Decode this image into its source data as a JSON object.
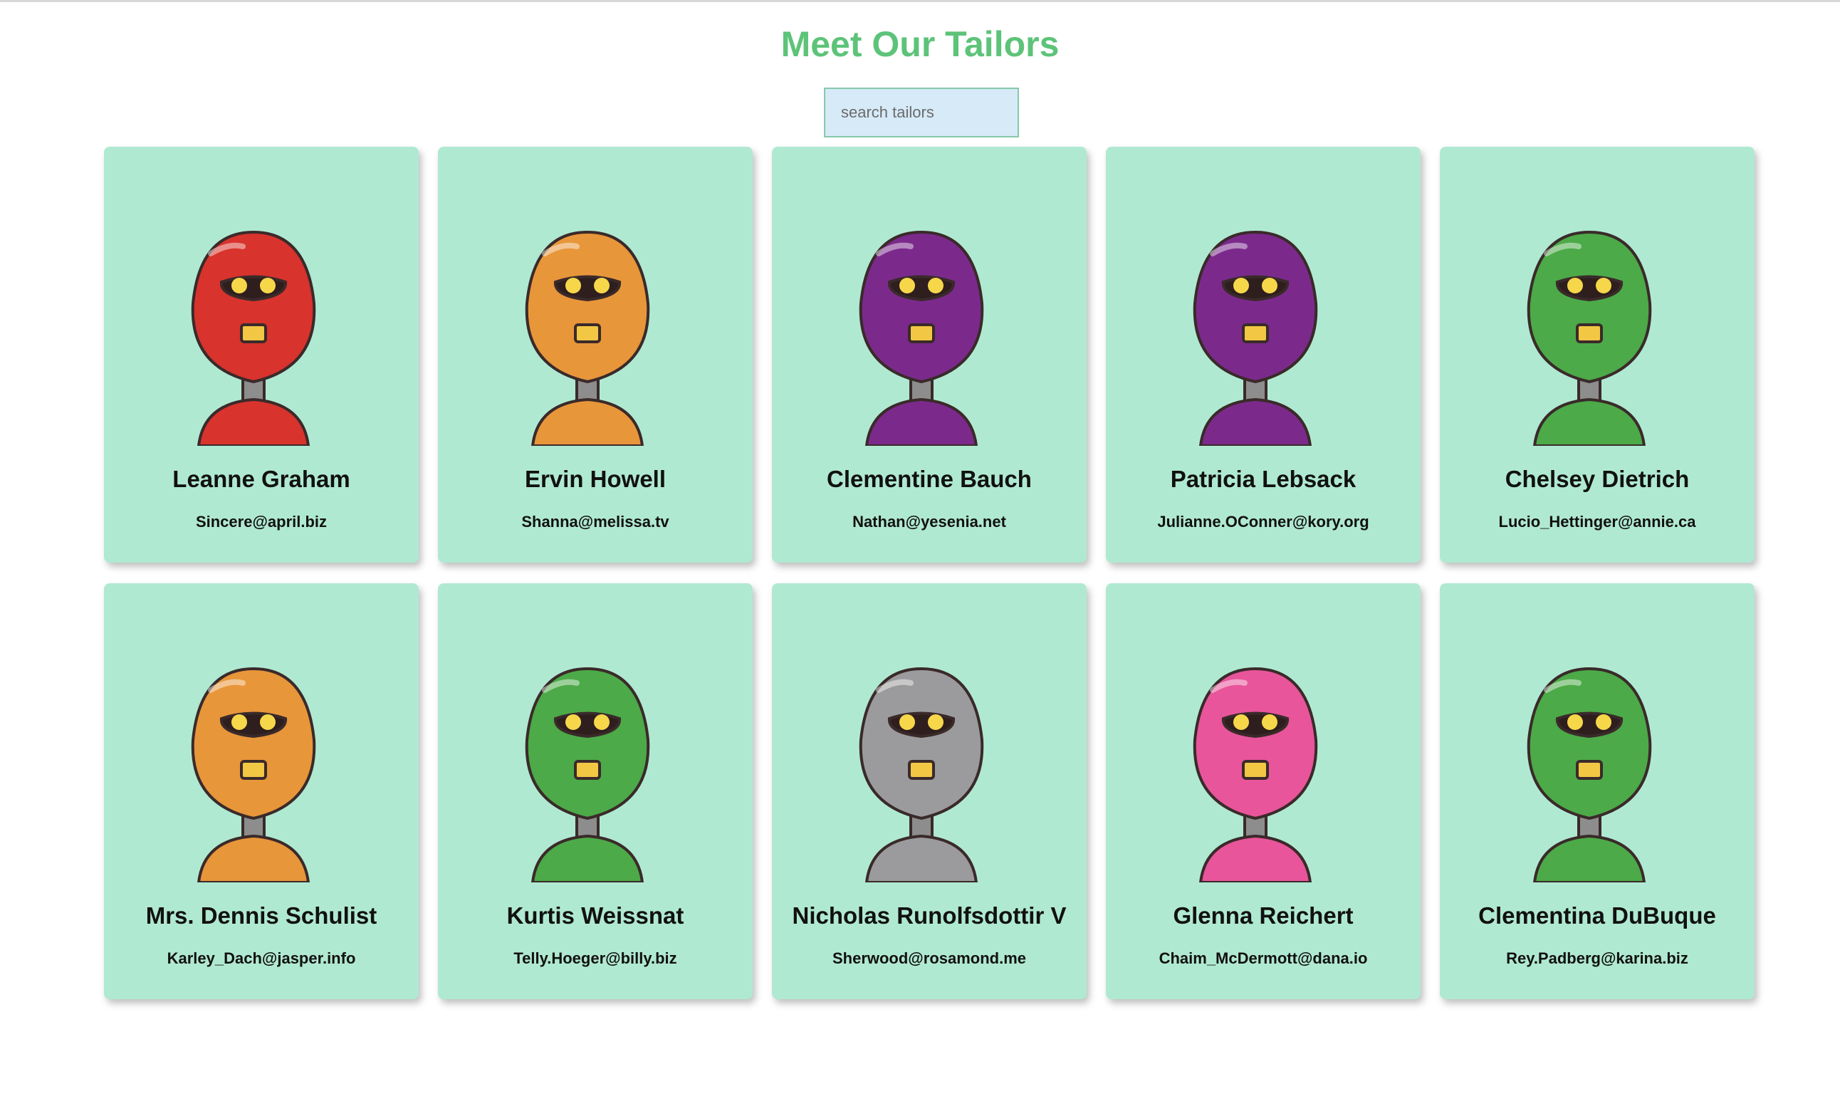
{
  "page": {
    "title": "Meet Our Tailors"
  },
  "search": {
    "placeholder": "search tailors",
    "value": ""
  },
  "tailors": [
    {
      "name": "Leanne Graham",
      "email": "Sincere@april.biz",
      "robot_color": "#d8332d",
      "avatar_icon": "red-robot-avatar"
    },
    {
      "name": "Ervin Howell",
      "email": "Shanna@melissa.tv",
      "robot_color": "#e8963a",
      "avatar_icon": "orange-robot-avatar"
    },
    {
      "name": "Clementine Bauch",
      "email": "Nathan@yesenia.net",
      "robot_color": "#7b2a8c",
      "avatar_icon": "purple-robot-avatar"
    },
    {
      "name": "Patricia Lebsack",
      "email": "Julianne.OConner@kory.org",
      "robot_color": "#7b2a8c",
      "avatar_icon": "purple-robot-avatar"
    },
    {
      "name": "Chelsey Dietrich",
      "email": "Lucio_Hettinger@annie.ca",
      "robot_color": "#4caa48",
      "avatar_icon": "green-robot-avatar"
    },
    {
      "name": "Mrs. Dennis Schulist",
      "email": "Karley_Dach@jasper.info",
      "robot_color": "#e8963a",
      "avatar_icon": "orange-robot-avatar"
    },
    {
      "name": "Kurtis Weissnat",
      "email": "Telly.Hoeger@billy.biz",
      "robot_color": "#4caa48",
      "avatar_icon": "green-robot-avatar"
    },
    {
      "name": "Nicholas Runolfsdottir V",
      "email": "Sherwood@rosamond.me",
      "robot_color": "#9b9b9d",
      "avatar_icon": "gray-robot-avatar"
    },
    {
      "name": "Glenna Reichert",
      "email": "Chaim_McDermott@dana.io",
      "robot_color": "#e8559a",
      "avatar_icon": "pink-robot-avatar"
    },
    {
      "name": "Clementina DuBuque",
      "email": "Rey.Padberg@karina.biz",
      "robot_color": "#4caa48",
      "avatar_icon": "green-robot-avatar"
    }
  ]
}
